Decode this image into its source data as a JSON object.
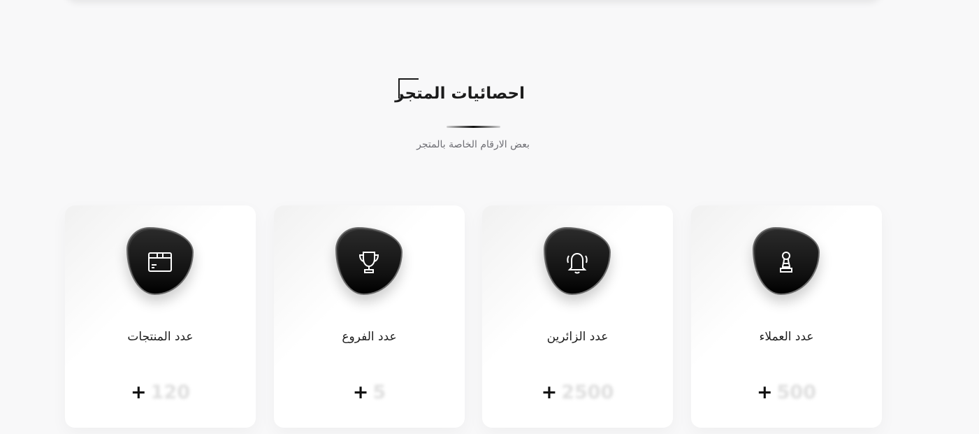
{
  "header": {
    "title": "احصائيات المتجر",
    "subtitle": "بعض الارقام الخاصة بالمتجر"
  },
  "stats": [
    {
      "label": "عدد المنتجات",
      "value": "120",
      "plus": "+",
      "icon": "box-icon"
    },
    {
      "label": "عدد الفروع",
      "value": "5",
      "plus": "+",
      "icon": "trophy-icon"
    },
    {
      "label": "عدد الزائرين",
      "value": "2500",
      "plus": "+",
      "icon": "bell-icon"
    },
    {
      "label": "عدد العملاء",
      "value": "500",
      "plus": "+",
      "icon": "chess-pawn-icon"
    }
  ],
  "colors": {
    "background": "#f8f8f9",
    "card": "#ffffff",
    "icon_bg": "#111111",
    "text": "#1d1d1d",
    "muted": "#6e6e74"
  }
}
